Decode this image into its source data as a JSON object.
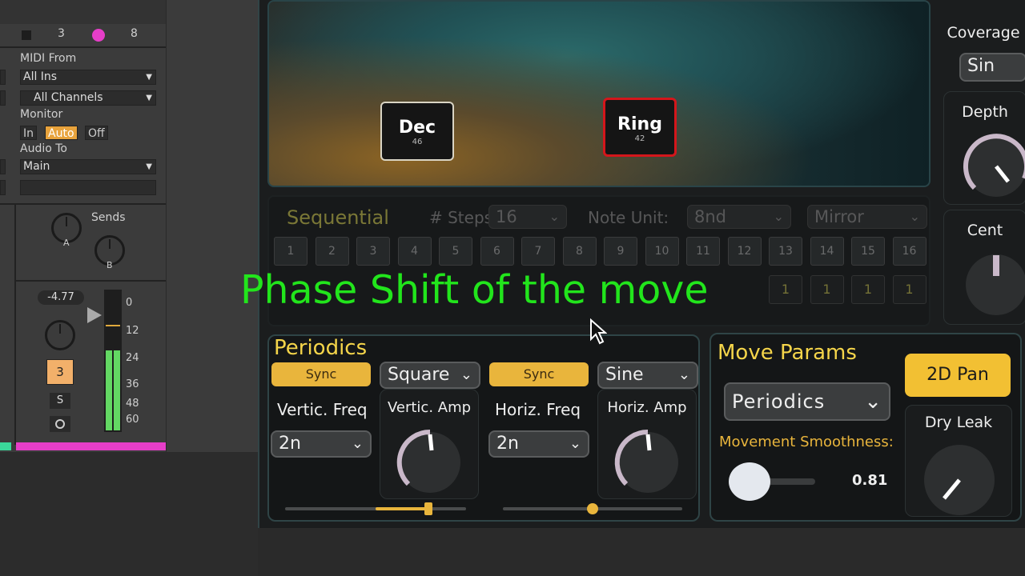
{
  "track": {
    "top_number_left": "3",
    "top_number_right": "8",
    "midi_from_label": "MIDI From",
    "midi_from_value": "All Ins",
    "channel_value": "All Channels",
    "monitor_label": "Monitor",
    "monitor_options": [
      "In",
      "Auto",
      "Off"
    ],
    "monitor_selected": "Auto",
    "audio_to_label": "Audio To",
    "audio_to_value": "Main",
    "sends_label": "Sends",
    "send_a": "A",
    "send_b": "B",
    "volume_value": "-4.77",
    "track_number": "3",
    "solo_label": "S",
    "meter_scale": [
      "0",
      "12",
      "24",
      "36",
      "48",
      "60"
    ],
    "accent_color": "#e63ec8"
  },
  "stage": {
    "nodes": [
      {
        "label": "Dec",
        "number": "46"
      },
      {
        "label": "Ring",
        "number": "42"
      }
    ]
  },
  "sequential": {
    "title": "Sequential",
    "steps_label": "# Steps",
    "steps_value": "16",
    "note_unit_label": "Note Unit:",
    "note_unit_value": "8nd",
    "mode_value": "Mirror",
    "step_numbers": [
      "1",
      "2",
      "3",
      "4",
      "5",
      "6",
      "7",
      "8",
      "9",
      "10",
      "11",
      "12",
      "13",
      "14",
      "15",
      "16"
    ],
    "step_values": [
      "1",
      "1",
      "1",
      "1"
    ]
  },
  "periodics": {
    "title": "Periodics",
    "sync_left": "Sync",
    "sync_right": "Sync",
    "wave_left": "Square",
    "wave_right": "Sine",
    "vert_freq_label": "Vertic. Freq",
    "vert_freq_value": "2n",
    "vert_amp_label": "Vertic. Amp",
    "horiz_freq_label": "Horiz. Freq",
    "horiz_freq_value": "2n",
    "horiz_amp_label": "Horiz. Amp",
    "phase_left": 0.7,
    "phase_right": 0.5
  },
  "move_params": {
    "title": "Move Params",
    "pan_button": "2D Pan",
    "mode_value": "Periodics",
    "smoothness_label": "Movement Smoothness:",
    "smoothness_value": "0.81",
    "dry_leak_label": "Dry Leak"
  },
  "right_panel": {
    "coverage_label": "Coverage",
    "coverage_value": "Sin",
    "depth_label": "Depth",
    "cent_label": "Cent"
  },
  "overlay_text": "Phase Shift of the move",
  "colors": {
    "accent_yellow": "#e9b53c",
    "title_yellow": "#f5d54a",
    "overlay_green": "#22e51c",
    "ring_border": "#d4161b",
    "dec_border": "#d9d4c4"
  }
}
